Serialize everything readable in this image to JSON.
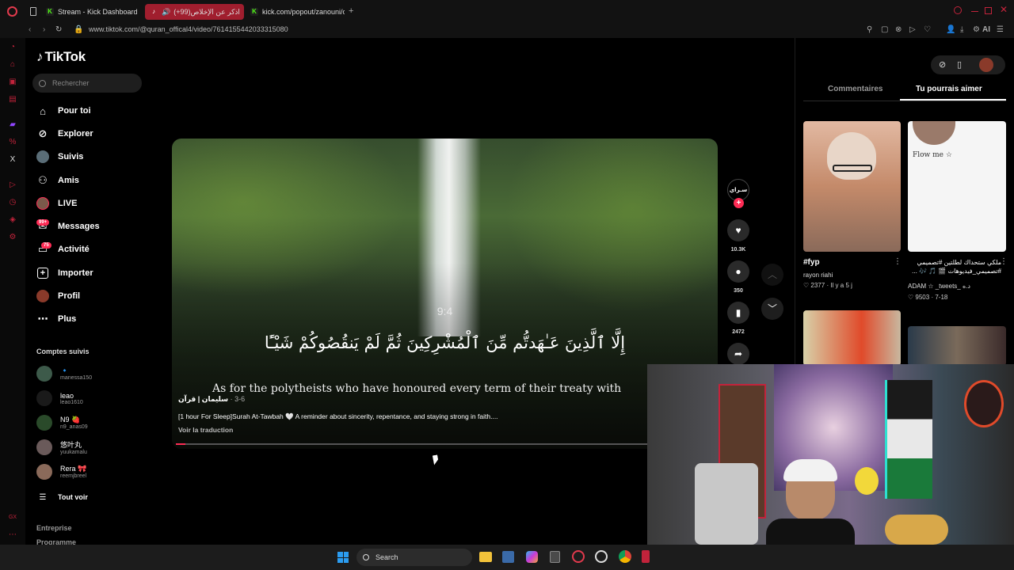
{
  "browser": {
    "tabs": [
      {
        "label": "Stream - Kick Dashboard",
        "active": false
      },
      {
        "label": "(+99)اذكر عن الإخلاص",
        "active": true
      },
      {
        "label": "kick.com/popout/zanouni/c",
        "active": false
      }
    ],
    "url": "www.tiktok.com/@quran_offical4/video/7614155442033315080",
    "ai_label": "AI"
  },
  "tiktok": {
    "logo": "TikTok",
    "search_placeholder": "Rechercher",
    "nav": [
      {
        "label": "Pour toi",
        "icon": "home-icon"
      },
      {
        "label": "Explorer",
        "icon": "compass-icon"
      },
      {
        "label": "Suivis",
        "icon": "avatar-icon"
      },
      {
        "label": "Amis",
        "icon": "friends-icon"
      },
      {
        "label": "LIVE",
        "icon": "live-icon"
      },
      {
        "label": "Messages",
        "icon": "messages-icon",
        "badge": "99+"
      },
      {
        "label": "Activité",
        "icon": "activity-icon",
        "badge": "75"
      },
      {
        "label": "Importer",
        "icon": "upload-icon"
      },
      {
        "label": "Profil",
        "icon": "profile-icon"
      },
      {
        "label": "Plus",
        "icon": "more-icon"
      }
    ],
    "followed_title": "Comptes suivis",
    "followed": [
      {
        "name": "",
        "handle": "manessa150"
      },
      {
        "name": "leao",
        "handle": "leao1610"
      },
      {
        "name": "N9 🍓",
        "handle": "n9_anas09"
      },
      {
        "name": "悠叶丸",
        "handle": "yuukamalu"
      },
      {
        "name": "Rera 🎀",
        "handle": "reemjbreel"
      }
    ],
    "see_all": "Tout voir",
    "footer": [
      "Entreprise",
      "Programme"
    ]
  },
  "video": {
    "verse_number": "9:4",
    "arabic_text": "إِلَّا ٱلَّذِينَ عَـٰهَدتُّم مِّنَ ٱلْمُشْرِكِينَ ثُمَّ لَمْ يَنقُصُوكُمْ شَيْـًٔا",
    "translation": "As for the polytheists who have honoured every term of their treaty with",
    "author": "سليمان | قرآن",
    "date": "3-6",
    "caption": "[1 hour For Sleep]Surah At-Tawbah 🤍 A reminder about sincerity, repentance, and staying strong in faith....",
    "translate_label": "Voir la traduction",
    "progress": 0.02
  },
  "actions": {
    "creator_avatar_text": "سـراي",
    "likes": "10.3K",
    "comments": "350",
    "saves": "2472"
  },
  "right_panel": {
    "tabs": [
      "Commentaires",
      "Tu pourrais aimer"
    ],
    "active_tab": "Tu pourrais aimer",
    "cards": [
      {
        "title": "#fyp",
        "author": "rayon riahi",
        "likes": "2377",
        "time": "Il y a 5 j",
        "overlay": ""
      },
      {
        "title": "ملكي ستحداك لطلتين #تصميمي #تصميمي_فيديوهات 🎬 🎵 🎶 ...",
        "author": "ADAM ☆ _tweets_ د.ه",
        "likes": "9503",
        "time": "7-18",
        "overlay": "Flow me ☆"
      }
    ]
  },
  "taskbar": {
    "search_label": "Search"
  }
}
